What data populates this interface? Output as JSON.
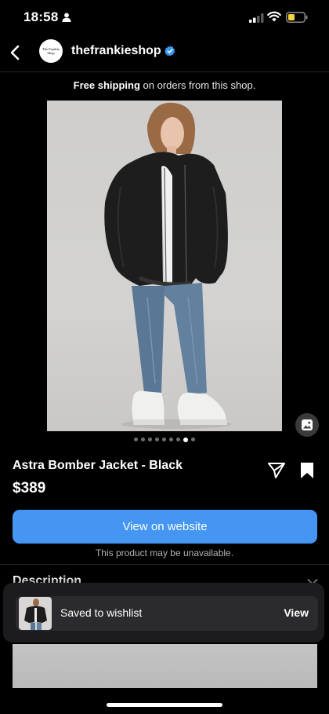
{
  "status_bar": {
    "time": "18:58"
  },
  "header": {
    "avatar_text": "The Frankie Shop",
    "username": "thefrankieshop"
  },
  "shipping": {
    "bold": "Free shipping",
    "rest": " on orders from this shop."
  },
  "carousel": {
    "count": 9,
    "active_index": 7
  },
  "product": {
    "title": "Astra Bomber Jacket - Black",
    "price": "$389",
    "cta_label": "View on website",
    "availability_note": "This product may be unavailable."
  },
  "description": {
    "label": "Description"
  },
  "toast": {
    "message": "Saved to wishlist",
    "action": "View"
  },
  "colors": {
    "accent": "#4496f2",
    "background": "#000000",
    "verified": "#3897f0"
  },
  "icons": [
    "person-icon",
    "signal-icon",
    "wifi-icon",
    "battery-icon",
    "back-icon",
    "verified-icon",
    "image-icon",
    "share-icon",
    "bookmark-icon",
    "chevron-down-icon"
  ]
}
